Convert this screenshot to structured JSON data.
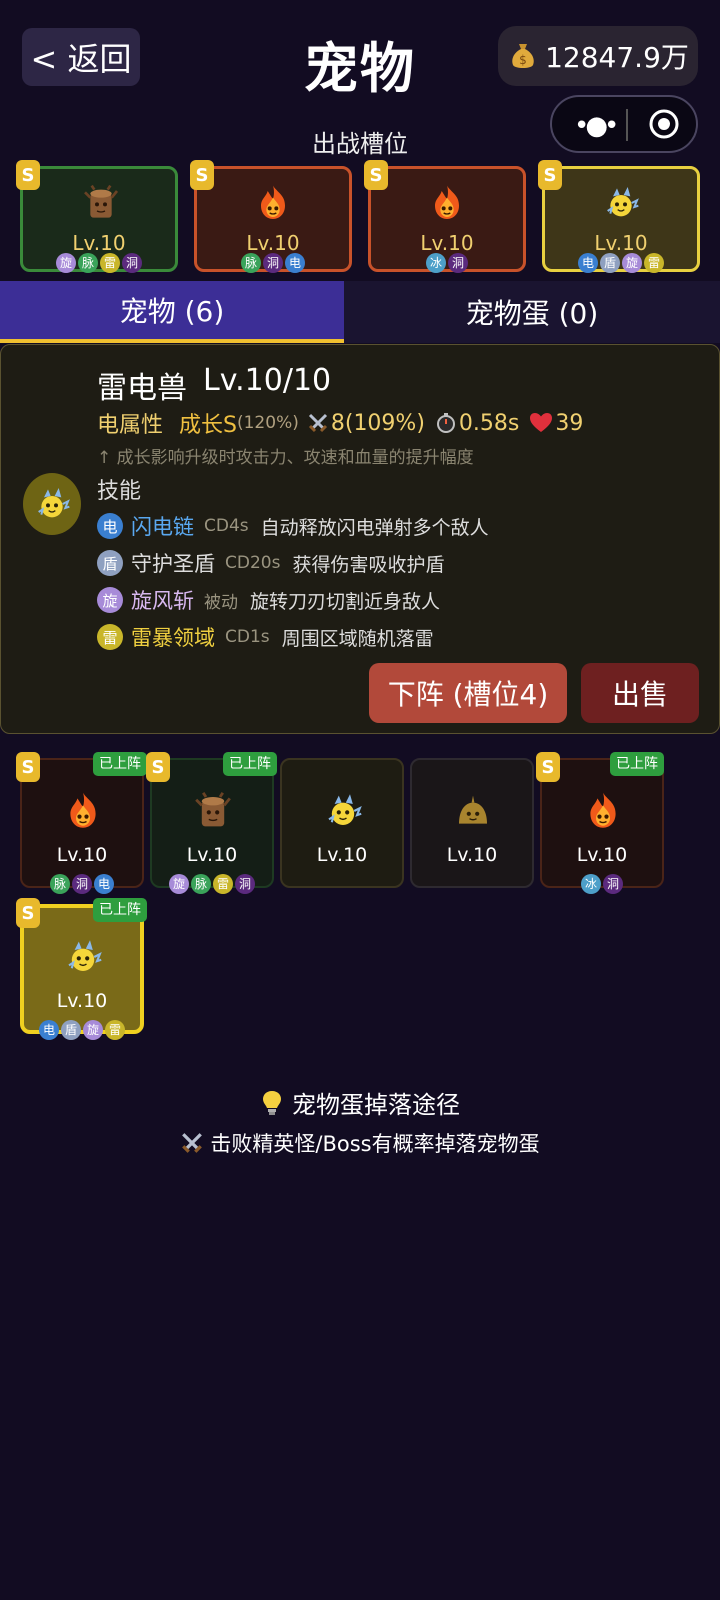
{
  "header": {
    "back_label": "< 返回",
    "title": "宠物",
    "coins": "12847.9万"
  },
  "slots": {
    "title": "出战槽位",
    "items": [
      {
        "rank": "S",
        "level": "Lv.10",
        "pet": "tree-stump",
        "tags": [
          "旋",
          "脉",
          "雷",
          "洞"
        ]
      },
      {
        "rank": "S",
        "level": "Lv.10",
        "pet": "fire-spirit",
        "tags": [
          "脉",
          "洞",
          "电"
        ]
      },
      {
        "rank": "S",
        "level": "Lv.10",
        "pet": "fire-spirit",
        "tags": [
          "冰",
          "洞"
        ]
      },
      {
        "rank": "S",
        "level": "Lv.10",
        "pet": "thunder-beast",
        "tags": [
          "电",
          "盾",
          "旋",
          "雷"
        ]
      }
    ]
  },
  "tabs": {
    "pets": "宠物 (6)",
    "eggs": "宠物蛋 (0)"
  },
  "detail": {
    "name": "雷电兽",
    "level": "Lv.10/10",
    "attribute": "电属性",
    "growth": "成长S",
    "growth_pct": "(120%)",
    "attack": "8(109%)",
    "speed": "0.58s",
    "hp": "39",
    "hint": "↑ 成长影响升级时攻击力、攻速和血量的提升幅度",
    "skills_title": "技能",
    "skills": [
      {
        "badge": "电",
        "name": "闪电链",
        "cd": "CD4s",
        "desc": "自动释放闪电弹射多个敌人",
        "color": "#5aa8f0",
        "badge_color": "#3a7fd0"
      },
      {
        "badge": "盾",
        "name": "守护圣盾",
        "cd": "CD20s",
        "desc": "获得伤害吸收护盾",
        "color": "#dddddd",
        "badge_color": "#8fa0c0"
      },
      {
        "badge": "旋",
        "name": "旋风斩",
        "cd": "被动",
        "desc": "旋转刀刃切割近身敌人",
        "color": "#d8b8f0",
        "badge_color": "#a78bd8"
      },
      {
        "badge": "雷",
        "name": "雷暴领域",
        "cd": "CD1s",
        "desc": "周围区域随机落雷",
        "color": "#f0d040",
        "badge_color": "#c9b62a"
      }
    ],
    "unequip_label": "下阵 (槽位4)",
    "sell_label": "出售"
  },
  "pets": [
    {
      "rank": "S",
      "equipped": "已上阵",
      "level": "Lv.10",
      "pet": "fire-spirit",
      "tags": [
        "脉",
        "洞",
        "电"
      ]
    },
    {
      "rank": "S",
      "equipped": "已上阵",
      "level": "Lv.10",
      "pet": "tree-stump",
      "tags": [
        "旋",
        "脉",
        "雷",
        "洞"
      ]
    },
    {
      "rank": "",
      "equipped": "",
      "level": "Lv.10",
      "pet": "thunder-beast",
      "tags": []
    },
    {
      "rank": "",
      "equipped": "",
      "level": "Lv.10",
      "pet": "mud-creature",
      "tags": []
    },
    {
      "rank": "S",
      "equipped": "已上阵",
      "level": "Lv.10",
      "pet": "fire-spirit",
      "tags": [
        "冰",
        "洞"
      ]
    },
    {
      "rank": "S",
      "equipped": "已上阵",
      "level": "Lv.10",
      "pet": "thunder-beast",
      "tags": [
        "电",
        "盾",
        "旋",
        "雷"
      ]
    }
  ],
  "footer": {
    "egg_title": "宠物蛋掉落途径",
    "egg_desc": "击败精英怪/Boss有概率掉落宠物蛋"
  }
}
